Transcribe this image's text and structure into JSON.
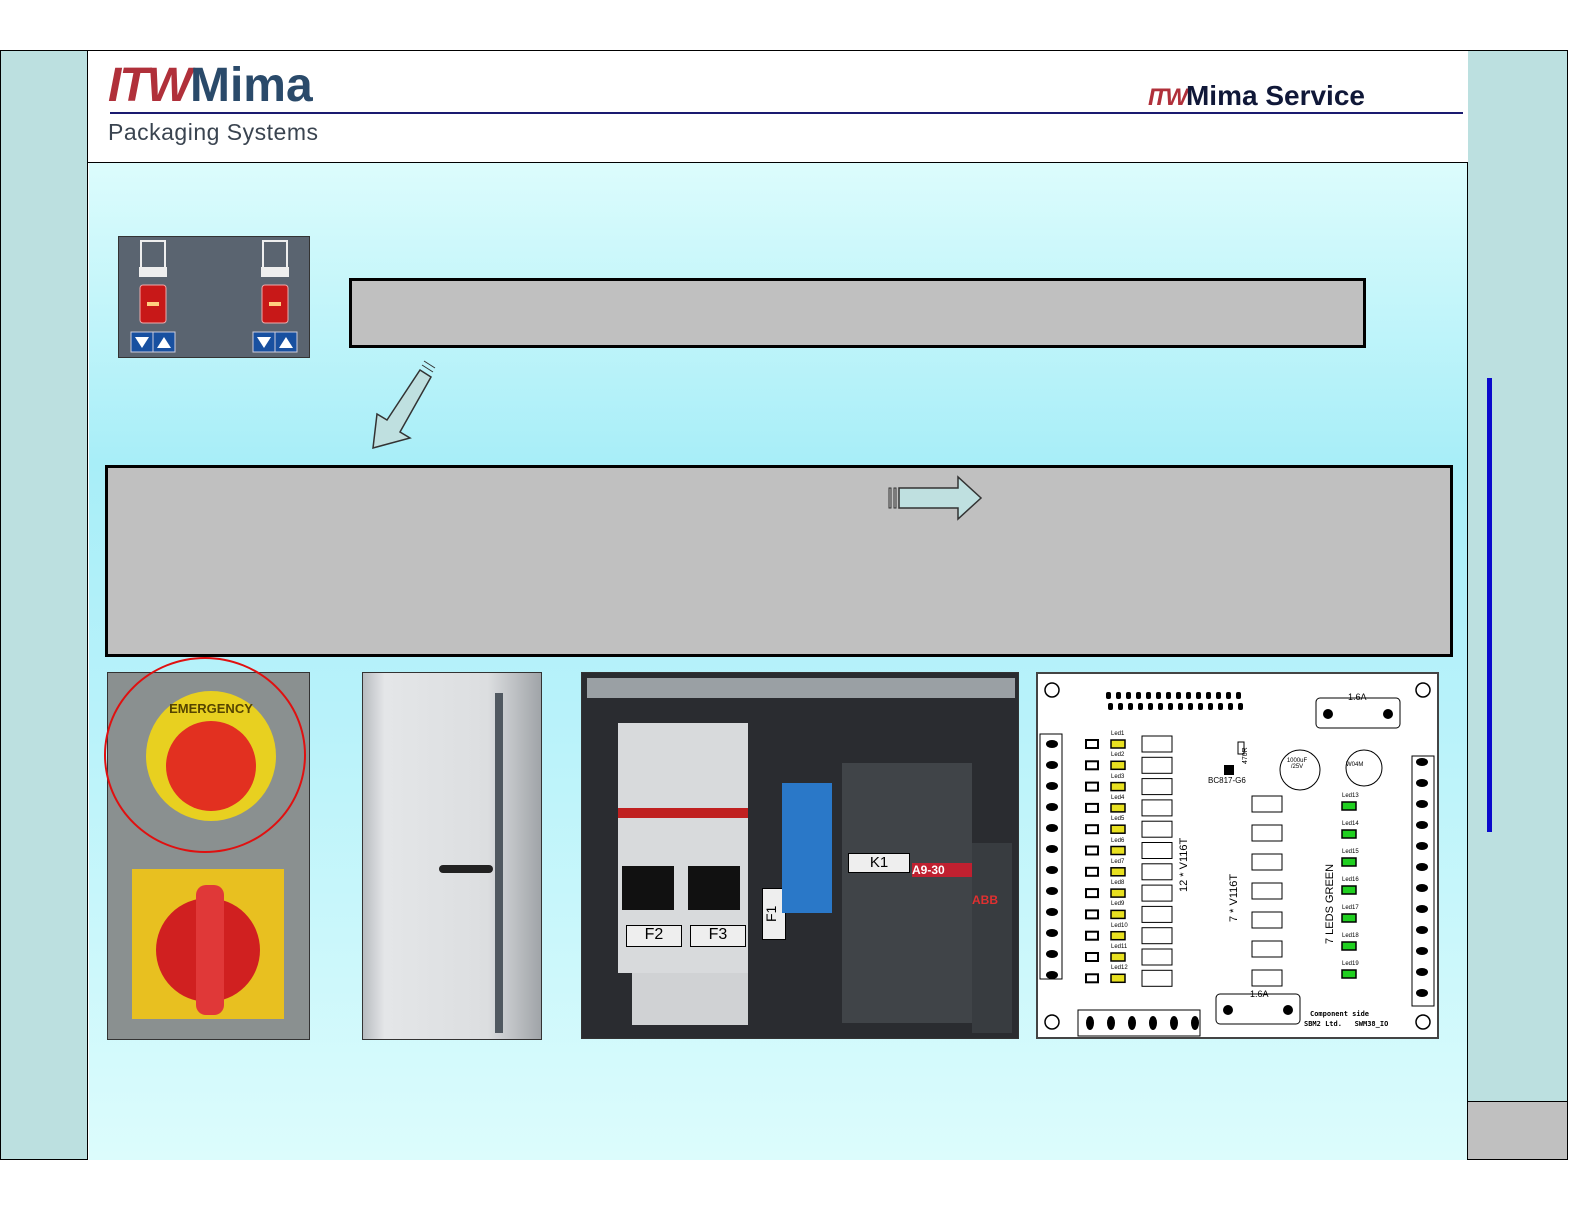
{
  "header": {
    "logo_itw": "ITW",
    "logo_mima": "Mima",
    "subtitle": "Packaging Systems",
    "service_itw": "ITW",
    "service_label": "Mima Service"
  },
  "colors": {
    "accent_blue": "#0a0acc",
    "logo_red": "#b0303a",
    "logo_navy": "#2a4a6a",
    "box_gray": "#c0c0c0",
    "sidebar": "#bce0e0"
  },
  "icons": [
    "tray-icon",
    "red-indicator-icon",
    "down-arrow-button",
    "up-arrow-button",
    "arrow-down-left-icon",
    "arrow-right-icon",
    "emergency-stop-button",
    "main-switch",
    "cabinet-door",
    "electrical-panel",
    "pcb-layout"
  ],
  "panel_photo": {
    "labels": [
      "F2",
      "F3",
      "F1",
      "K1",
      "A9-30",
      "ABB"
    ]
  },
  "emergency_photo": {
    "label": "EMERGENCY"
  },
  "pcb": {
    "fuse_label": "1.6A",
    "yellow_leds": [
      "Led1",
      "Led2",
      "Led3",
      "Led4",
      "Led5",
      "Led6",
      "Led7",
      "Led8",
      "Led9",
      "Led10",
      "Led11",
      "Led12"
    ],
    "green_leds": [
      "Led13",
      "Led14",
      "Led15",
      "Led16",
      "Led17",
      "Led18",
      "Led19"
    ],
    "opto_label_1": "12 * V116T",
    "opto_label_2": "7 * V116T",
    "green_label": "7 LEDS GREEN",
    "transistor": "BC817-G6",
    "resistor": "470R",
    "capacitor": "1000uF /25V",
    "bridge": "W04M",
    "footer_1": "Component side",
    "footer_2": "SBM2 Ltd.   SWM38_IO"
  }
}
